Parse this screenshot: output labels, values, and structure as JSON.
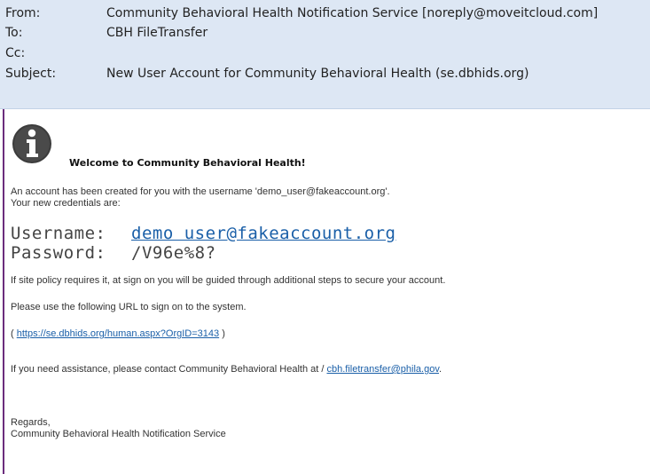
{
  "header": {
    "from_label": "From:",
    "from_value": "Community Behavioral Health Notification Service [noreply@moveitcloud.com]",
    "to_label": "To:",
    "to_value": "CBH FileTransfer",
    "cc_label": "Cc:",
    "cc_value": "",
    "subject_label": "Subject:",
    "subject_value": "New User Account for Community Behavioral Health (se.dbhids.org)"
  },
  "message": {
    "info_icon": "info-circle-icon",
    "welcome": "Welcome to Community Behavioral Health!",
    "account_line": "An account has been created for you with the username 'demo_user@fakeaccount.org'.",
    "credentials_line": "Your new credentials are:",
    "username_label": "Username:",
    "username_value": "demo user@fakeaccount.org",
    "password_label": "Password:",
    "password_value": "/V96e%8?",
    "policy_line": "If site policy requires it, at sign on you will be guided through additional steps to secure your account.",
    "url_intro": "Please use the following URL to sign on to the system.",
    "url_open": "(",
    "url_link": "https://se.dbhids.org/human.aspx?OrgID=3143",
    "url_close": ")",
    "assist_text": "If you need assistance, please contact Community Behavioral Health at /",
    "assist_email": "cbh.filetransfer@phila.gov",
    "assist_end": ".",
    "regards": "Regards,",
    "signature": "Community Behavioral Health Notification Service"
  },
  "colors": {
    "header_bg": "#dde7f4",
    "link": "#1a5fa8",
    "frame": "#6b2d7d"
  }
}
